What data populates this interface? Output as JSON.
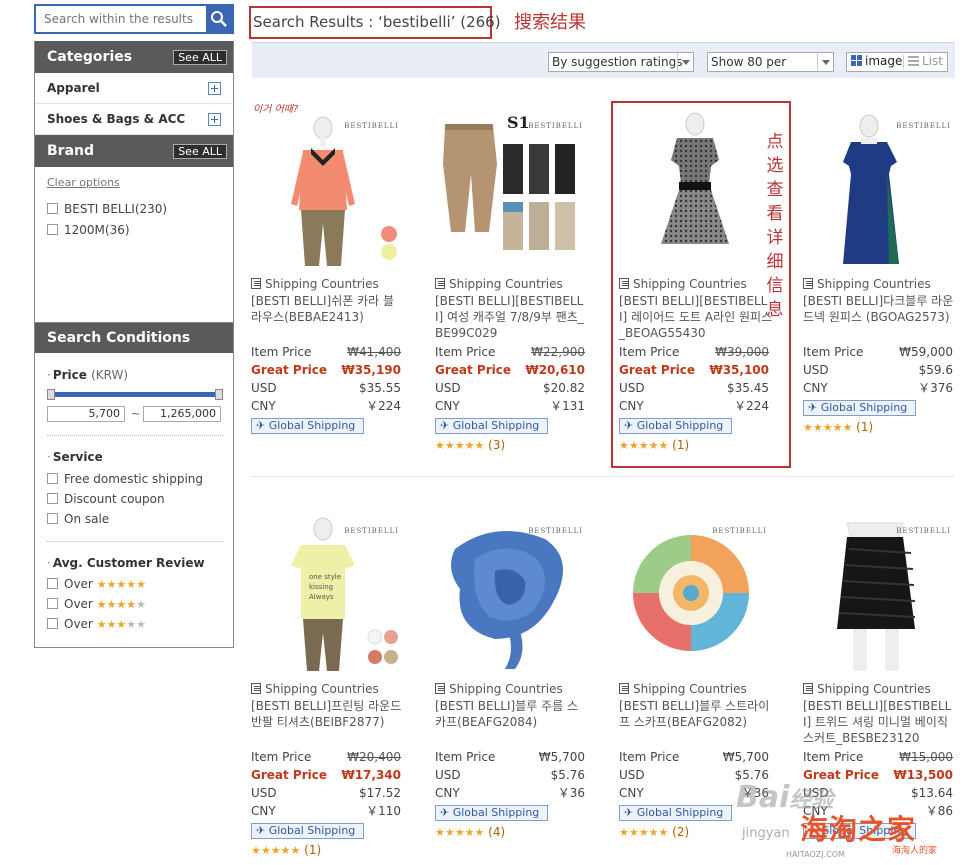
{
  "search": {
    "placeholder": "Search within the results"
  },
  "sidebar": {
    "categories": {
      "title": "Categories",
      "see_all": "See ALL",
      "items": [
        "Apparel",
        "Shoes & Bags & ACC"
      ]
    },
    "brand": {
      "title": "Brand",
      "see_all": "See ALL",
      "clear": "Clear options",
      "items": [
        "BESTI BELLI(230)",
        "1200M(36)"
      ]
    },
    "conditions": {
      "title": "Search Conditions",
      "price_label": "Price",
      "price_unit": "(KRW)",
      "price_min": "5,700",
      "price_sep": "~",
      "price_max": "1,265,000",
      "service_label": "Service",
      "service_items": [
        "Free domestic shipping",
        "Discount coupon",
        "On sale"
      ],
      "review_label": "Avg. Customer Review",
      "review_items": [
        {
          "label": "Over",
          "stars": 5
        },
        {
          "label": "Over",
          "stars": 4
        },
        {
          "label": "Over",
          "stars": 3
        }
      ]
    }
  },
  "results": {
    "title": "Search Results : ‘bestibelli’ (266)",
    "annotation": "搜索结果",
    "sort": "By suggestion ratings",
    "per_page": "Show 80 per",
    "view_image": "image",
    "view_list": "List",
    "highlight_annotation": [
      "点",
      "选",
      "查",
      "看",
      "详",
      "细",
      "信",
      "息"
    ]
  },
  "labels": {
    "shipping_countries": "Shipping Countries",
    "item_price": "Item Price",
    "great_price": "Great Price",
    "usd": "USD",
    "cny": "CNY",
    "global_shipping": "Global Shipping"
  },
  "products": [
    {
      "brand_mark": "BESTIBELLI",
      "name": "[BESTI BELLI]쉬폰 카라 블라우스(BEBAE2413)",
      "item_price": "₩41,400",
      "great_price": "₩35,190",
      "usd": "$35.55",
      "cny": "￥224",
      "rating_count": "",
      "sticker": "이거 어때?"
    },
    {
      "brand_mark": "BESTIBELLI",
      "name": "[BESTI BELLI][BESTIBELLI] 여성 캐주얼 7/8/9부 팬츠_BE99C029",
      "item_price": "₩22,900",
      "great_price": "₩20,610",
      "usd": "$20.82",
      "cny": "￥131",
      "rating_count": "(3)",
      "sticker": ""
    },
    {
      "brand_mark": "BESTIBELLI",
      "name": "[BESTI BELLI][BESTIBELLI] 레이어드 도트 A라인 원피스_BEOAG55430",
      "item_price": "₩39,000",
      "great_price": "₩35,100",
      "usd": "$35.45",
      "cny": "￥224",
      "rating_count": "(1)",
      "sticker": ""
    },
    {
      "brand_mark": "BESTIBELLI",
      "name": "[BESTI BELLI]다크블루 라운드넥 원피스 (BGOAG2573)",
      "item_price": "₩59,000",
      "great_price": "",
      "usd": "$59.6",
      "cny": "￥376",
      "rating_count": "(1)",
      "sticker": ""
    },
    {
      "brand_mark": "BESTIBELLI",
      "name": "[BESTI BELLI]프린팅 라운드 반팔 티셔츠(BEIBF2877)",
      "item_price": "₩20,400",
      "great_price": "₩17,340",
      "usd": "$17.52",
      "cny": "￥110",
      "rating_count": "(1)",
      "sticker": ""
    },
    {
      "brand_mark": "BESTIBELLI",
      "name": "[BESTI BELLI]블루 주름 스카프(BEAFG2084)",
      "item_price": "₩5,700",
      "great_price": "",
      "usd": "$5.76",
      "cny": "￥36",
      "rating_count": "(4)",
      "sticker": ""
    },
    {
      "brand_mark": "BESTIBELLI",
      "name": "[BESTI BELLI]블루 스트라이프 스카프(BEAFG2082)",
      "item_price": "₩5,700",
      "great_price": "",
      "usd": "$5.76",
      "cny": "￥36",
      "rating_count": "(2)",
      "sticker": ""
    },
    {
      "brand_mark": "BESTIBELLI",
      "name": "[BESTI BELLI][BESTIBELLI] 트위드 셔링 미니멀 베이직 스커트_BESBE23120",
      "item_price": "₩15,000",
      "great_price": "₩13,500",
      "usd": "$13.64",
      "cny": "￥86",
      "rating_count": "",
      "sticker": ""
    }
  ],
  "watermark": {
    "baidu": "Bai",
    "baidu2": "经验",
    "site": "jingyan",
    "haitao": "海淘之家",
    "haitao_url": "HAITAOZJ.COM",
    "haitao_sub": "海淘人的家"
  },
  "colors": {
    "accent": "#3a66b3",
    "highlight": "#bb3333",
    "great_price": "#c0391b"
  }
}
